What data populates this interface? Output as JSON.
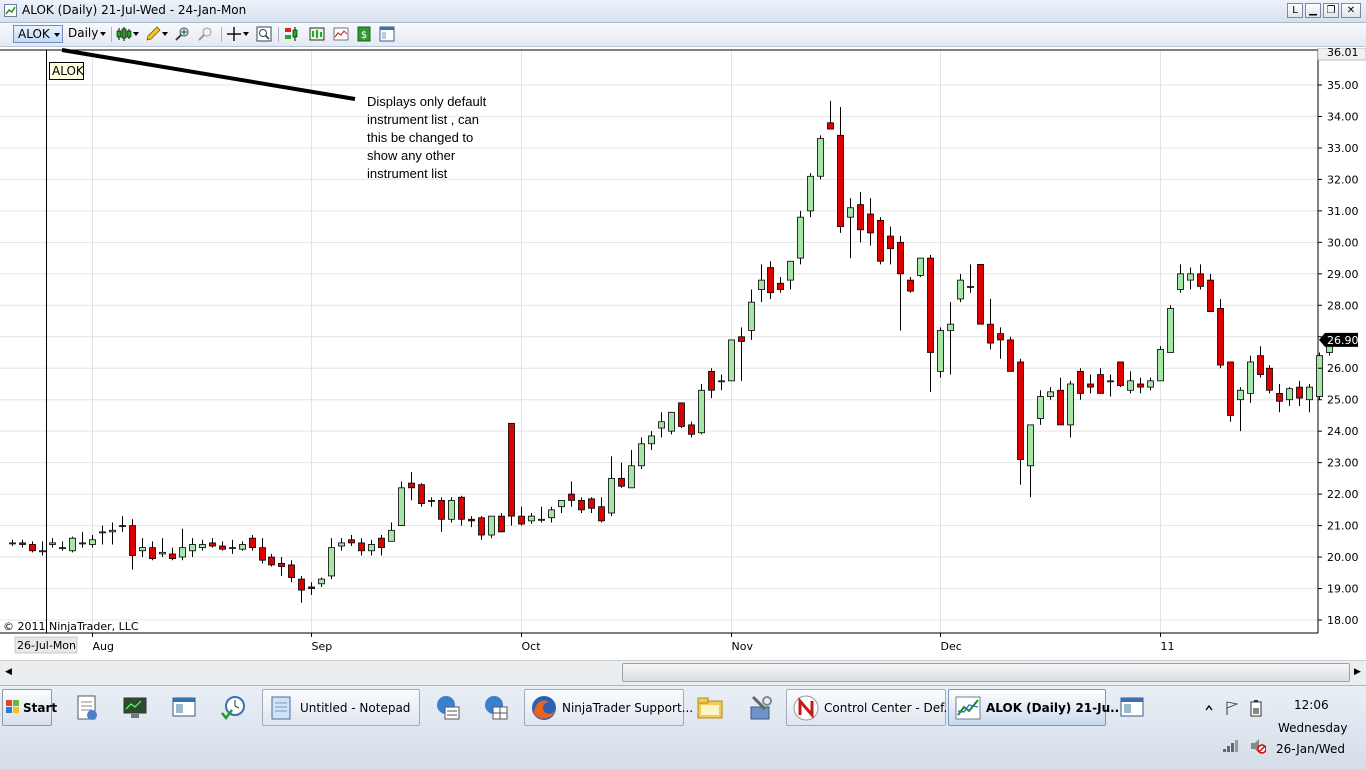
{
  "window": {
    "title": "ALOK (Daily)  21-Jul-Wed - 24-Jan-Mon",
    "buttons": {
      "help": "L",
      "minimize": "▁",
      "maximize": "❐",
      "close": "✕"
    }
  },
  "toolbar": {
    "instrument": "ALOK",
    "period": "Daily",
    "tooltip": "ALOK"
  },
  "annotation": {
    "lines": [
      "Displays only default",
      "instrument list , can",
      "this be changed to",
      "show any other",
      "instrument list"
    ]
  },
  "chart_data": {
    "type": "candlestick",
    "symbol": "ALOK",
    "interval": "Daily",
    "ylim": [
      17.7,
      36.4
    ],
    "price_axis_ticks": [
      "18.00",
      "19.00",
      "20.00",
      "21.00",
      "22.00",
      "23.00",
      "24.00",
      "25.00",
      "26.00",
      "27.00",
      "28.00",
      "29.00",
      "30.00",
      "31.00",
      "32.00",
      "33.00",
      "34.00",
      "35.00"
    ],
    "axis_top_label": "36.01",
    "last_price": "26.90",
    "x_labels": [
      "26-Jul-Mon",
      "Aug",
      "Sep",
      "Oct",
      "Nov",
      "Dec",
      "11"
    ],
    "copyright": "© 2011 NinjaTrader, LLC",
    "colors": {
      "up": "#a6e6a6",
      "down": "#e00000",
      "wick": "#000000",
      "grid": "#e4e4e4"
    },
    "candles": [
      {
        "o": 20.45,
        "h": 20.55,
        "l": 20.35,
        "c": 20.45
      },
      {
        "o": 20.45,
        "h": 20.55,
        "l": 20.3,
        "c": 20.4
      },
      {
        "o": 20.4,
        "h": 20.5,
        "l": 20.15,
        "c": 20.2
      },
      {
        "o": 20.2,
        "h": 20.5,
        "l": 20.05,
        "c": 20.2
      },
      {
        "o": 20.4,
        "h": 20.6,
        "l": 20.3,
        "c": 20.45
      },
      {
        "o": 20.3,
        "h": 20.5,
        "l": 20.2,
        "c": 20.3
      },
      {
        "o": 20.2,
        "h": 20.65,
        "l": 20.15,
        "c": 20.6
      },
      {
        "o": 20.45,
        "h": 20.8,
        "l": 20.3,
        "c": 20.45
      },
      {
        "o": 20.4,
        "h": 20.7,
        "l": 20.3,
        "c": 20.55
      },
      {
        "o": 20.8,
        "h": 21.0,
        "l": 20.4,
        "c": 20.8
      },
      {
        "o": 20.8,
        "h": 21.1,
        "l": 20.4,
        "c": 20.85
      },
      {
        "o": 21.0,
        "h": 21.3,
        "l": 20.8,
        "c": 21.0
      },
      {
        "o": 21.0,
        "h": 21.2,
        "l": 19.6,
        "c": 20.05
      },
      {
        "o": 20.2,
        "h": 20.6,
        "l": 20.0,
        "c": 20.3
      },
      {
        "o": 20.3,
        "h": 20.5,
        "l": 19.9,
        "c": 19.95
      },
      {
        "o": 20.1,
        "h": 20.6,
        "l": 20.0,
        "c": 20.15
      },
      {
        "o": 20.1,
        "h": 20.3,
        "l": 19.9,
        "c": 19.95
      },
      {
        "o": 20.0,
        "h": 20.9,
        "l": 19.9,
        "c": 20.3
      },
      {
        "o": 20.2,
        "h": 20.6,
        "l": 20.0,
        "c": 20.4
      },
      {
        "o": 20.3,
        "h": 20.55,
        "l": 20.2,
        "c": 20.4
      },
      {
        "o": 20.45,
        "h": 20.6,
        "l": 20.3,
        "c": 20.35
      },
      {
        "o": 20.35,
        "h": 20.5,
        "l": 20.2,
        "c": 20.25
      },
      {
        "o": 20.3,
        "h": 20.55,
        "l": 20.1,
        "c": 20.3
      },
      {
        "o": 20.25,
        "h": 20.5,
        "l": 20.2,
        "c": 20.4
      },
      {
        "o": 20.6,
        "h": 20.7,
        "l": 20.2,
        "c": 20.3
      },
      {
        "o": 20.3,
        "h": 20.6,
        "l": 19.8,
        "c": 19.9
      },
      {
        "o": 20.0,
        "h": 20.1,
        "l": 19.7,
        "c": 19.75
      },
      {
        "o": 19.8,
        "h": 20.0,
        "l": 19.4,
        "c": 19.7
      },
      {
        "o": 19.75,
        "h": 19.9,
        "l": 19.2,
        "c": 19.35
      },
      {
        "o": 19.3,
        "h": 19.4,
        "l": 18.55,
        "c": 18.95
      },
      {
        "o": 19.05,
        "h": 19.2,
        "l": 18.8,
        "c": 19.0
      },
      {
        "o": 19.15,
        "h": 19.35,
        "l": 19.05,
        "c": 19.3
      },
      {
        "o": 19.4,
        "h": 20.6,
        "l": 19.3,
        "c": 20.3
      },
      {
        "o": 20.35,
        "h": 20.6,
        "l": 20.2,
        "c": 20.45
      },
      {
        "o": 20.55,
        "h": 20.7,
        "l": 20.35,
        "c": 20.45
      },
      {
        "o": 20.45,
        "h": 20.6,
        "l": 20.05,
        "c": 20.2
      },
      {
        "o": 20.2,
        "h": 20.55,
        "l": 20.05,
        "c": 20.4
      },
      {
        "o": 20.6,
        "h": 20.7,
        "l": 20.05,
        "c": 20.3
      },
      {
        "o": 20.5,
        "h": 21.1,
        "l": 20.5,
        "c": 20.85
      },
      {
        "o": 21.0,
        "h": 22.4,
        "l": 21.0,
        "c": 22.2
      },
      {
        "o": 22.35,
        "h": 22.7,
        "l": 21.8,
        "c": 22.2
      },
      {
        "o": 22.3,
        "h": 22.35,
        "l": 21.6,
        "c": 21.7
      },
      {
        "o": 21.8,
        "h": 21.9,
        "l": 21.6,
        "c": 21.8
      },
      {
        "o": 21.8,
        "h": 21.9,
        "l": 20.8,
        "c": 21.2
      },
      {
        "o": 21.2,
        "h": 21.9,
        "l": 21.1,
        "c": 21.8
      },
      {
        "o": 21.9,
        "h": 21.95,
        "l": 21.0,
        "c": 21.2
      },
      {
        "o": 21.2,
        "h": 21.3,
        "l": 20.95,
        "c": 21.15
      },
      {
        "o": 21.25,
        "h": 21.3,
        "l": 20.55,
        "c": 20.7
      },
      {
        "o": 20.7,
        "h": 21.3,
        "l": 20.6,
        "c": 21.3
      },
      {
        "o": 21.3,
        "h": 21.4,
        "l": 20.8,
        "c": 20.8
      },
      {
        "o": 24.25,
        "h": 24.25,
        "l": 21.0,
        "c": 21.3
      },
      {
        "o": 21.3,
        "h": 21.6,
        "l": 21.0,
        "c": 21.05
      },
      {
        "o": 21.15,
        "h": 21.4,
        "l": 21.05,
        "c": 21.3
      },
      {
        "o": 21.2,
        "h": 21.6,
        "l": 21.1,
        "c": 21.2
      },
      {
        "o": 21.25,
        "h": 21.6,
        "l": 21.1,
        "c": 21.5
      },
      {
        "o": 21.6,
        "h": 21.7,
        "l": 21.4,
        "c": 21.8
      },
      {
        "o": 22.0,
        "h": 22.4,
        "l": 21.6,
        "c": 21.8
      },
      {
        "o": 21.8,
        "h": 21.9,
        "l": 21.4,
        "c": 21.5
      },
      {
        "o": 21.85,
        "h": 21.9,
        "l": 21.4,
        "c": 21.55
      },
      {
        "o": 21.6,
        "h": 21.9,
        "l": 21.1,
        "c": 21.15
      },
      {
        "o": 21.4,
        "h": 23.2,
        "l": 21.3,
        "c": 22.5
      },
      {
        "o": 22.5,
        "h": 23.0,
        "l": 22.2,
        "c": 22.25
      },
      {
        "o": 22.2,
        "h": 23.4,
        "l": 22.2,
        "c": 22.9
      },
      {
        "o": 22.9,
        "h": 23.8,
        "l": 22.8,
        "c": 23.6
      },
      {
        "o": 23.6,
        "h": 24.0,
        "l": 23.4,
        "c": 23.85
      },
      {
        "o": 24.1,
        "h": 24.6,
        "l": 23.8,
        "c": 24.3
      },
      {
        "o": 24.0,
        "h": 24.6,
        "l": 23.9,
        "c": 24.6
      },
      {
        "o": 24.9,
        "h": 24.9,
        "l": 24.1,
        "c": 24.15
      },
      {
        "o": 24.2,
        "h": 24.3,
        "l": 23.8,
        "c": 23.9
      },
      {
        "o": 23.95,
        "h": 25.5,
        "l": 23.9,
        "c": 25.3
      },
      {
        "o": 25.9,
        "h": 26.0,
        "l": 25.05,
        "c": 25.3
      },
      {
        "o": 25.6,
        "h": 25.8,
        "l": 25.3,
        "c": 25.6
      },
      {
        "o": 25.6,
        "h": 26.9,
        "l": 25.6,
        "c": 26.9
      },
      {
        "o": 27.0,
        "h": 27.3,
        "l": 25.6,
        "c": 26.85
      },
      {
        "o": 27.2,
        "h": 28.5,
        "l": 26.9,
        "c": 28.1
      },
      {
        "o": 28.5,
        "h": 29.3,
        "l": 28.1,
        "c": 28.8
      },
      {
        "o": 29.2,
        "h": 29.4,
        "l": 28.2,
        "c": 28.4
      },
      {
        "o": 28.7,
        "h": 28.9,
        "l": 28.4,
        "c": 28.5
      },
      {
        "o": 28.8,
        "h": 29.4,
        "l": 28.5,
        "c": 29.4
      },
      {
        "o": 29.5,
        "h": 31.0,
        "l": 29.3,
        "c": 30.8
      },
      {
        "o": 31.0,
        "h": 32.2,
        "l": 30.8,
        "c": 32.1
      },
      {
        "o": 32.1,
        "h": 33.4,
        "l": 32.0,
        "c": 33.3
      },
      {
        "o": 33.8,
        "h": 34.5,
        "l": 33.6,
        "c": 33.6
      },
      {
        "o": 33.4,
        "h": 34.3,
        "l": 30.3,
        "c": 30.5
      },
      {
        "o": 30.8,
        "h": 31.4,
        "l": 29.5,
        "c": 31.1
      },
      {
        "o": 31.2,
        "h": 31.6,
        "l": 30.0,
        "c": 30.4
      },
      {
        "o": 30.9,
        "h": 31.4,
        "l": 29.9,
        "c": 30.3
      },
      {
        "o": 30.7,
        "h": 30.8,
        "l": 29.3,
        "c": 29.4
      },
      {
        "o": 30.2,
        "h": 30.5,
        "l": 29.3,
        "c": 29.8
      },
      {
        "o": 30.0,
        "h": 30.2,
        "l": 27.2,
        "c": 29.0
      },
      {
        "o": 28.8,
        "h": 28.9,
        "l": 28.4,
        "c": 28.45
      },
      {
        "o": 28.95,
        "h": 29.5,
        "l": 28.9,
        "c": 29.5
      },
      {
        "o": 29.5,
        "h": 29.6,
        "l": 25.25,
        "c": 26.5
      },
      {
        "o": 25.9,
        "h": 27.3,
        "l": 25.7,
        "c": 27.2
      },
      {
        "o": 27.2,
        "h": 28.1,
        "l": 25.8,
        "c": 27.4
      },
      {
        "o": 28.2,
        "h": 29.0,
        "l": 28.1,
        "c": 28.8
      },
      {
        "o": 28.6,
        "h": 29.3,
        "l": 28.4,
        "c": 28.6
      },
      {
        "o": 29.3,
        "h": 29.3,
        "l": 27.4,
        "c": 27.4
      },
      {
        "o": 27.4,
        "h": 28.2,
        "l": 26.6,
        "c": 26.8
      },
      {
        "o": 27.1,
        "h": 27.3,
        "l": 26.3,
        "c": 26.9
      },
      {
        "o": 26.9,
        "h": 27.0,
        "l": 25.9,
        "c": 25.9
      },
      {
        "o": 26.2,
        "h": 26.3,
        "l": 22.3,
        "c": 23.1
      },
      {
        "o": 22.9,
        "h": 24.2,
        "l": 21.9,
        "c": 24.2
      },
      {
        "o": 24.4,
        "h": 25.3,
        "l": 24.2,
        "c": 25.1
      },
      {
        "o": 25.1,
        "h": 25.4,
        "l": 25.0,
        "c": 25.25
      },
      {
        "o": 25.3,
        "h": 25.7,
        "l": 24.2,
        "c": 24.2
      },
      {
        "o": 24.2,
        "h": 25.6,
        "l": 23.8,
        "c": 25.5
      },
      {
        "o": 25.9,
        "h": 26.0,
        "l": 25.0,
        "c": 25.2
      },
      {
        "o": 25.5,
        "h": 25.8,
        "l": 25.2,
        "c": 25.4
      },
      {
        "o": 25.8,
        "h": 26.0,
        "l": 25.2,
        "c": 25.2
      },
      {
        "o": 25.6,
        "h": 25.8,
        "l": 25.1,
        "c": 25.6
      },
      {
        "o": 26.2,
        "h": 26.2,
        "l": 25.4,
        "c": 25.45
      },
      {
        "o": 25.3,
        "h": 25.9,
        "l": 25.2,
        "c": 25.6
      },
      {
        "o": 25.5,
        "h": 25.7,
        "l": 25.2,
        "c": 25.4
      },
      {
        "o": 25.4,
        "h": 25.7,
        "l": 25.3,
        "c": 25.6
      },
      {
        "o": 25.6,
        "h": 26.7,
        "l": 25.6,
        "c": 26.6
      },
      {
        "o": 26.5,
        "h": 28.0,
        "l": 26.5,
        "c": 27.9
      },
      {
        "o": 28.5,
        "h": 29.3,
        "l": 28.4,
        "c": 29.0
      },
      {
        "o": 28.8,
        "h": 29.2,
        "l": 28.5,
        "c": 29.0
      },
      {
        "o": 29.0,
        "h": 29.3,
        "l": 28.5,
        "c": 28.6
      },
      {
        "o": 28.8,
        "h": 29.0,
        "l": 27.8,
        "c": 27.8
      },
      {
        "o": 27.9,
        "h": 28.2,
        "l": 26.0,
        "c": 26.1
      },
      {
        "o": 26.2,
        "h": 26.2,
        "l": 24.3,
        "c": 24.5
      },
      {
        "o": 25.0,
        "h": 25.4,
        "l": 24.0,
        "c": 25.3
      },
      {
        "o": 25.2,
        "h": 26.4,
        "l": 24.9,
        "c": 26.2
      },
      {
        "o": 26.4,
        "h": 26.7,
        "l": 25.7,
        "c": 25.8
      },
      {
        "o": 26.0,
        "h": 26.1,
        "l": 25.2,
        "c": 25.3
      },
      {
        "o": 25.2,
        "h": 25.5,
        "l": 24.6,
        "c": 24.95
      },
      {
        "o": 25.0,
        "h": 25.4,
        "l": 24.8,
        "c": 25.35
      },
      {
        "o": 25.4,
        "h": 25.6,
        "l": 24.8,
        "c": 25.05
      },
      {
        "o": 25.0,
        "h": 25.5,
        "l": 24.6,
        "c": 25.4
      },
      {
        "o": 25.1,
        "h": 26.5,
        "l": 25.0,
        "c": 26.4
      },
      {
        "o": 26.5,
        "h": 26.9,
        "l": 26.4,
        "c": 26.9
      }
    ]
  },
  "scrollbar": {
    "left_arrow": "◀",
    "right_arrow": "▶"
  },
  "taskbar": {
    "start": "Start",
    "items": [
      {
        "label": "Untitled - Notepad"
      },
      {
        "label": "NinjaTrader Support..."
      },
      {
        "label": "Control Center - Def..."
      },
      {
        "label": "ALOK (Daily)  21-Ju..."
      }
    ],
    "clock": {
      "time": "12:06",
      "day": "Wednesday",
      "date": "26-Jan/Wed"
    }
  }
}
